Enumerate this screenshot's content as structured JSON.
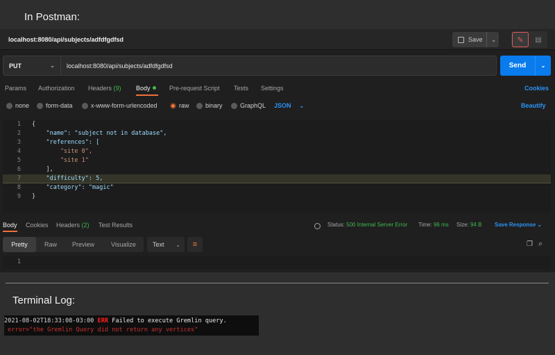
{
  "heading_postman": "In Postman:",
  "heading_terminal": "Terminal Log:",
  "postman": {
    "tab_title": "localhost:8080/api/subjects/adfdfgdfsd",
    "save_label": "Save",
    "method": "PUT",
    "url": "localhost:8080/api/subjects/adfdfgdfsd",
    "send_label": "Send",
    "request_tabs": {
      "params": "Params",
      "authorization": "Authorization",
      "headers": "Headers",
      "headers_count": "(9)",
      "body": "Body",
      "prerequest": "Pre-request Script",
      "tests": "Tests",
      "settings": "Settings",
      "cookies": "Cookies"
    },
    "body_options": {
      "none": "none",
      "form_data": "form-data",
      "urlencoded": "x-www-form-urlencoded",
      "raw": "raw",
      "binary": "binary",
      "graphql": "GraphQL",
      "format": "JSON",
      "beautify": "Beautify",
      "selected": "raw"
    },
    "request_body_lines": [
      {
        "num": "1",
        "text": "{"
      },
      {
        "num": "2",
        "text": "    \"name\": \"subject not in database\","
      },
      {
        "num": "3",
        "text": "    \"references\": ["
      },
      {
        "num": "4",
        "text": "        \"site 0\","
      },
      {
        "num": "5",
        "text": "        \"site 1\""
      },
      {
        "num": "6",
        "text": "    ],"
      },
      {
        "num": "7",
        "text": "    \"difficulty\": 5,"
      },
      {
        "num": "8",
        "text": "    \"category\": \"magic\""
      },
      {
        "num": "9",
        "text": "}"
      }
    ],
    "response_tabs": {
      "body": "Body",
      "cookies": "Cookies",
      "headers": "Headers",
      "headers_count": "(2)",
      "test_results": "Test Results"
    },
    "status_label": "Status:",
    "status_value": "500 Internal Server Error",
    "time_label": "Time:",
    "time_value": "96 ms",
    "size_label": "Size:",
    "size_value": "94 B",
    "save_response": "Save Response",
    "view_modes": {
      "pretty": "Pretty",
      "raw": "Raw",
      "preview": "Preview",
      "visualize": "Visualize"
    },
    "response_format": "Text",
    "response_line_num": "1"
  },
  "terminal": {
    "timestamp": "2021-08-02T18:33:08-03:00",
    "level": "ERR",
    "message": "Failed to execute Gremlin query.",
    "error_detail": " error=\"the Gremlin Query did not return any vertices\""
  },
  "colors": {
    "send": "#097bed",
    "accent": "#f0703a",
    "link": "#2b93f5",
    "status_error_shown": "#3fb950",
    "terminal_error": "#ff2020"
  }
}
